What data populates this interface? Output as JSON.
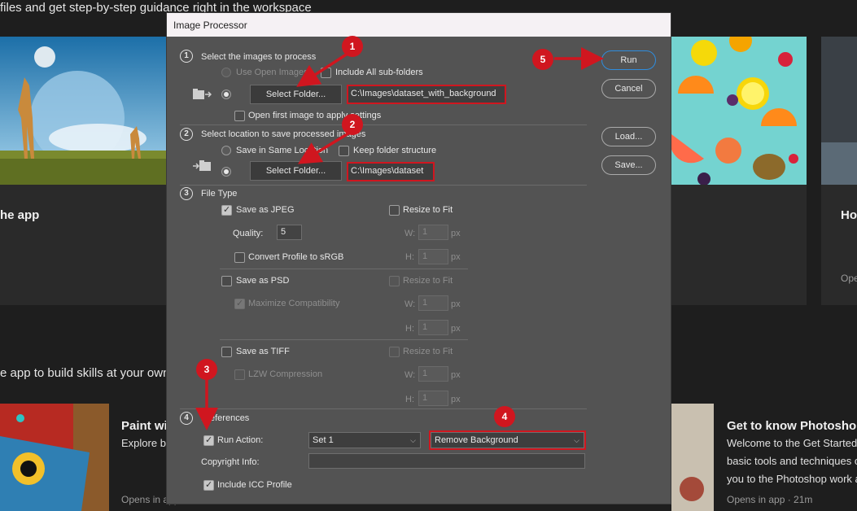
{
  "background": {
    "top_text": "files and get step-by-step guidance right in the workspace",
    "card1_label": "he app",
    "card3_label": "Ho",
    "card3_sub": "Ope",
    "section_text": "e app to build skills at your own",
    "card_paint_title": "Paint wi",
    "card_paint_sub": "Explore b",
    "card_paint_meta": "Opens in app",
    "card_gtk_title": "Get to know Photoshop",
    "card_gtk_lines": [
      "Welcome to the Get Started",
      "basic tools and techniques o",
      "you to the Photoshop work a"
    ],
    "card_gtk_meta": "Opens in app  ·  21m"
  },
  "dialog": {
    "title": "Image Processor",
    "section1": {
      "number": "1",
      "heading": "Select the images to process",
      "use_open_images": "Use Open Images",
      "include_subfolders": "Include All sub-folders",
      "select_folder": "Select Folder...",
      "path": "C:\\Images\\dataset_with_background",
      "open_first": "Open first image to apply settings"
    },
    "section2": {
      "number": "2",
      "heading": "Select location to save processed images",
      "save_same": "Save in Same Location",
      "keep_structure": "Keep folder structure",
      "select_folder": "Select Folder...",
      "path": "C:\\Images\\dataset"
    },
    "section3": {
      "number": "3",
      "heading": "File Type",
      "save_jpeg": "Save as JPEG",
      "resize_to_fit": "Resize to Fit",
      "quality_label": "Quality:",
      "quality_value": "5",
      "w_label": "W:",
      "h_label": "H:",
      "px": "px",
      "dim_value": "1",
      "convert_profile": "Convert Profile to sRGB",
      "save_psd": "Save as PSD",
      "max_compat": "Maximize Compatibility",
      "save_tiff": "Save as TIFF",
      "lzw": "LZW Compression"
    },
    "section4": {
      "number": "4",
      "heading": "Preferences",
      "run_action": "Run Action:",
      "action_set": "Set 1",
      "action_name": "Remove Background",
      "copyright_label": "Copyright Info:",
      "copyright_value": "",
      "include_icc": "Include ICC Profile"
    },
    "buttons": {
      "run": "Run",
      "cancel": "Cancel",
      "load": "Load...",
      "save": "Save..."
    }
  },
  "annotations": [
    "1",
    "2",
    "3",
    "4",
    "5"
  ],
  "colors": {
    "annotation_red": "#d0161f",
    "dialog_bg": "#535353"
  }
}
